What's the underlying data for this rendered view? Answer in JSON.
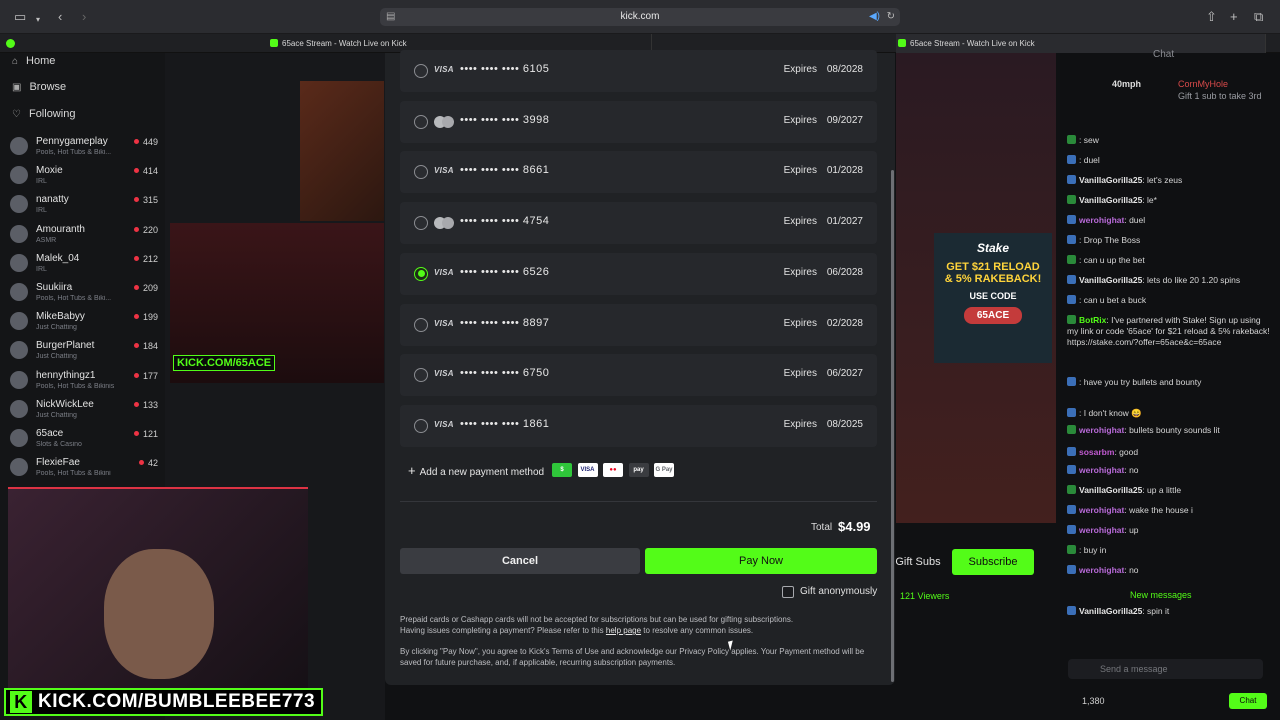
{
  "browser": {
    "url": "kick.com",
    "tabs": [
      "65ace Stream - Watch Live on Kick",
      "65ace Stream - Watch Live on Kick"
    ]
  },
  "sidebar": {
    "nav": [
      {
        "icon": "home-icon",
        "label": "Home"
      },
      {
        "icon": "browse-icon",
        "label": "Browse"
      },
      {
        "icon": "heart-icon",
        "label": "Following"
      }
    ],
    "channels": [
      {
        "name": "Pennygameplay",
        "category": "Pools, Hot Tubs & Biki...",
        "viewers": "449"
      },
      {
        "name": "Moxie",
        "category": "IRL",
        "viewers": "414"
      },
      {
        "name": "nanatty",
        "category": "IRL",
        "viewers": "315"
      },
      {
        "name": "Amouranth",
        "category": "ASMR",
        "viewers": "220"
      },
      {
        "name": "Malek_04",
        "category": "IRL",
        "viewers": "212"
      },
      {
        "name": "Suukiira",
        "category": "Pools, Hot Tubs & Biki...",
        "viewers": "209"
      },
      {
        "name": "MikeBabyy",
        "category": "Just Chatting",
        "viewers": "199"
      },
      {
        "name": "BurgerPlanet",
        "category": "Just Chatting",
        "viewers": "184"
      },
      {
        "name": "hennythingz1",
        "category": "Pools, Hot Tubs & Bikinis",
        "viewers": "177"
      },
      {
        "name": "NickWickLee",
        "category": "Just Chatting",
        "viewers": "133"
      },
      {
        "name": "65ace",
        "category": "Slots & Casino",
        "viewers": "121"
      },
      {
        "name": "FlexieFae",
        "category": "Pools, Hot Tubs & Bikini",
        "viewers": "42"
      }
    ]
  },
  "background": {
    "kick_tag": "KICK.COM/65ACE",
    "stake_ad": {
      "line1": "GET $21 RELOAD",
      "line2": "& 5% RAKEBACK!",
      "use_code": "USE CODE",
      "code": "65ACE"
    },
    "gift_subs": "Gift Subs",
    "subscribe": "Subscribe",
    "viewers": "121 Viewers"
  },
  "chat": {
    "title": "Chat",
    "pinned": {
      "user": "CornMyHole",
      "text": "Gift 1 sub to take 3rd",
      "amount": "40mph"
    },
    "messages": [
      {
        "user": "",
        "text": ": sew",
        "color": "#e04848"
      },
      {
        "user": "",
        "text": ": duel",
        "color": "#e04848"
      },
      {
        "user": "VanillaGorilla25",
        "text": ": let's zeus",
        "color": "#e6e6e6"
      },
      {
        "user": "VanillaGorilla25",
        "text": ": le*",
        "color": "#e6e6e6"
      },
      {
        "user": "werohighat",
        "text": ": duel",
        "color": "#b86ad8"
      },
      {
        "user": "",
        "text": ": Drop The Boss",
        "color": "#e04848"
      },
      {
        "user": "",
        "text": ": can u up the bet",
        "color": "#e04848"
      },
      {
        "user": "VanillaGorilla25",
        "text": ": lets do like 20 1.20 spins",
        "color": "#e6e6e6"
      },
      {
        "user": "",
        "text": ": can u bet a buck",
        "color": "#e04848"
      },
      {
        "user": "BotRix",
        "text": ": I've partnered with Stake! Sign up using my link or code '65ace' for $21 reload & 5% rakeback! https://stake.com/?offer=65ace&c=65ace",
        "color": "#53fc18"
      },
      {
        "user": "",
        "text": ": have you try bullets and bounty",
        "color": "#e04848"
      },
      {
        "user": "",
        "text": ": I don't know 😄",
        "color": "#e04848"
      },
      {
        "user": "werohighat",
        "text": ": bullets bounty sounds lit",
        "color": "#b86ad8"
      },
      {
        "user": "sosarbm",
        "text": ": good",
        "color": "#c05ad0"
      },
      {
        "user": "werohighat",
        "text": ": no",
        "color": "#b86ad8"
      },
      {
        "user": "VanillaGorilla25",
        "text": ": up a little",
        "color": "#e6e6e6"
      },
      {
        "user": "werohighat",
        "text": ": wake the house i",
        "color": "#b86ad8"
      },
      {
        "user": "werohighat",
        "text": ": up",
        "color": "#b86ad8"
      },
      {
        "user": "",
        "text": ": buy in",
        "color": "#e04848"
      },
      {
        "user": "werohighat",
        "text": ": no",
        "color": "#b86ad8"
      },
      {
        "user": "VanillaGorilla25",
        "text": ": spin it",
        "color": "#e6e6e6"
      }
    ],
    "new_messages": "New messages",
    "input_placeholder": "Send a message",
    "chat_button": "Chat",
    "viewer_count": "1,380"
  },
  "modal": {
    "cards": [
      {
        "brand": "VISA",
        "number": "•••• •••• •••• 6105",
        "expires_label": "Expires",
        "expires": "08/2028",
        "selected": false
      },
      {
        "brand": "mastercard",
        "number": "•••• •••• •••• 3998",
        "expires_label": "Expires",
        "expires": "09/2027",
        "selected": false
      },
      {
        "brand": "VISA",
        "number": "•••• •••• •••• 8661",
        "expires_label": "Expires",
        "expires": "01/2028",
        "selected": false
      },
      {
        "brand": "mastercard",
        "number": "•••• •••• •••• 4754",
        "expires_label": "Expires",
        "expires": "01/2027",
        "selected": false
      },
      {
        "brand": "VISA",
        "number": "•••• •••• •••• 6526",
        "expires_label": "Expires",
        "expires": "06/2028",
        "selected": true
      },
      {
        "brand": "VISA",
        "number": "•••• •••• •••• 8897",
        "expires_label": "Expires",
        "expires": "02/2028",
        "selected": false
      },
      {
        "brand": "VISA",
        "number": "•••• •••• •••• 6750",
        "expires_label": "Expires",
        "expires": "06/2027",
        "selected": false
      },
      {
        "brand": "VISA",
        "number": "•••• •••• •••• 1861",
        "expires_label": "Expires",
        "expires": "08/2025",
        "selected": false
      }
    ],
    "add_payment": "Add a new payment method",
    "payment_icons": [
      {
        "name": "cashapp-icon",
        "label": "$",
        "bg": "#2fc63a",
        "fg": "#fff"
      },
      {
        "name": "visa-icon",
        "label": "VISA",
        "bg": "#ffffff",
        "fg": "#1a1f71"
      },
      {
        "name": "mastercard-icon",
        "label": "●●",
        "bg": "#ffffff",
        "fg": "#eb001b"
      },
      {
        "name": "amazon-pay-icon",
        "label": "pay",
        "bg": "#3a3c40",
        "fg": "#fff"
      },
      {
        "name": "google-pay-icon",
        "label": "G Pay",
        "bg": "#ffffff",
        "fg": "#5f6368"
      }
    ],
    "total_label": "Total",
    "total_value": "$4.99",
    "cancel": "Cancel",
    "pay_now": "Pay Now",
    "gift_anonymously": "Gift anonymously",
    "note_prepaid": "Prepaid cards or Cashapp cards will not be accepted for subscriptions but can be used for gifting subscriptions.",
    "note_issues_pre": "Having issues completing a payment? Please refer to this",
    "note_issues_link": "help page",
    "note_issues_post": "to resolve any common issues.",
    "note_terms": "By clicking \"Pay Now\", you agree to Kick's Terms of Use and acknowledge our Privacy Policy applies. Your Payment method will be saved for future purchase, and, if applicable, recurring subscription payments."
  },
  "overlay": {
    "watermark": "KICK.COM/BUMBLEEBEE773"
  }
}
